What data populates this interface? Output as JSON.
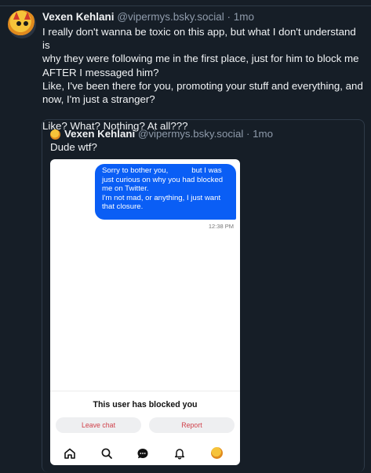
{
  "post": {
    "author_name": "Vexen Kehlani",
    "handle": "@vipermys.bsky.social",
    "separator": "·",
    "time": "1mo",
    "lines": [
      "I really don't wanna be toxic on this app, but what I don't understand is",
      "why they were following me in the first place, just for him to block me",
      "AFTER I messaged him?",
      "Like, I've been there for you, promoting your stuff and everything, and",
      "now, I'm just a stranger?",
      "Like? What? Nothing? At all???"
    ]
  },
  "quote": {
    "author_name": "Vexen Kehlani",
    "handle": "@vipermys.bsky.social",
    "separator": "·",
    "time": "1mo",
    "text": "Dude wtf?",
    "screenshot": {
      "message_part1": "Sorry to bother you,",
      "message_part2": "but I was just curious on why you had blocked me on Twitter.",
      "message_part3": "I'm not mad, or anything, I just want that closure.",
      "message_time": "12:38 PM",
      "blocked_notice": "This user has blocked you",
      "leave_chat_label": "Leave chat",
      "report_label": "Report",
      "nav_icons": [
        "home-icon",
        "search-icon",
        "chat-icon",
        "bell-icon",
        "profile-avatar"
      ]
    }
  },
  "colors": {
    "background": "#161e27",
    "bubble": "#0a5ef5",
    "danger_text": "#d0404a"
  }
}
